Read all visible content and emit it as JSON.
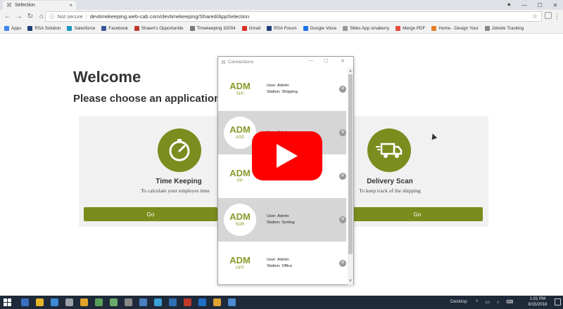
{
  "browser": {
    "tab_title": "Selection",
    "secure_label": "Not secure",
    "url": "devtimekeeping.web-cab.com/devtimekeeping/Shared/AppSelection"
  },
  "bookmarks": [
    {
      "label": "Apps",
      "color": "#4285f4"
    },
    {
      "label": "RSA Solution",
      "color": "#1f3f7a"
    },
    {
      "label": "Salesforce",
      "color": "#1798c1"
    },
    {
      "label": "Facebook",
      "color": "#3b5998"
    },
    {
      "label": "Shawn's Opportunitie",
      "color": "#c0392b"
    },
    {
      "label": "Timekeeping 32004",
      "color": "#7a7a7a"
    },
    {
      "label": "Gmail",
      "color": "#d93025"
    },
    {
      "label": "RSA Forum",
      "color": "#1f3f7a"
    },
    {
      "label": "Google Voice",
      "color": "#1a73e8"
    },
    {
      "label": "Stiles App smaberry",
      "color": "#999999"
    },
    {
      "label": "Merge PDF",
      "color": "#e74c3c"
    },
    {
      "label": "Home - Design Your",
      "color": "#e67e22"
    },
    {
      "label": "Jobsite Tracking",
      "color": "#888888"
    }
  ],
  "page": {
    "welcome": "Welcome",
    "choose": "Please choose an application",
    "apps": [
      {
        "title": "Time Keeping",
        "desc": "To calculate your employes time",
        "go": "Go"
      },
      {
        "title": "Delivery Scan",
        "desc": "To keep track of the shipping",
        "go": "Go"
      }
    ]
  },
  "dialog": {
    "title": "Connections",
    "connections": [
      {
        "code": "ADM",
        "sub": "SHI",
        "user": "User: Admin",
        "station": "Station: Shipping"
      },
      {
        "code": "ADM",
        "sub": "ASS",
        "user": "User: Admin",
        "station": ""
      },
      {
        "code": "ADM",
        "sub": "PP",
        "user": "",
        "station": ""
      },
      {
        "code": "ADM",
        "sub": "SOR",
        "user": "User: Admin",
        "station": "Station: Sorting"
      },
      {
        "code": "ADM",
        "sub": "OFF",
        "user": "User: Admin",
        "station": "Station: Office"
      }
    ]
  },
  "taskbar": {
    "desktop_label": "Desktop",
    "time": "1:01 PM",
    "date": "8/15/2018"
  },
  "colors": {
    "accent": "#7b8c1c",
    "play": "#ff0000",
    "taskbar": "#1e2a3a"
  }
}
